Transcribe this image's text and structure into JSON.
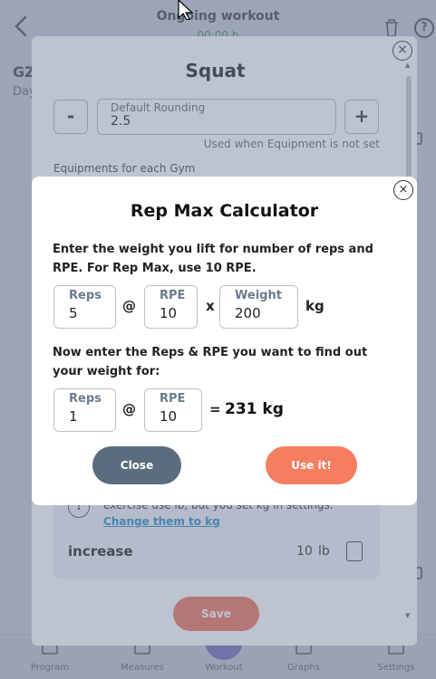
{
  "header": {
    "title": "Ongoing workout",
    "timer": "00:00 h"
  },
  "background": {
    "code": "GZ",
    "subtitle": "Day"
  },
  "bottom_nav": {
    "items": [
      "Program",
      "Measures",
      "Workout",
      "Graphs",
      "Settings"
    ]
  },
  "exercise_modal": {
    "title": "Squat",
    "minus_label": "-",
    "plus_label": "+",
    "rounding_label": "Default Rounding",
    "rounding_value": "2.5",
    "rounding_hint": "Used when Equipment is not set",
    "equipments_label": "Equipments for each Gym",
    "info_text": "exercise use lb, but you set kg in settings.",
    "info_link": "Change them to kg",
    "increase_label": "increase",
    "increase_value": "10",
    "increase_unit": "lb",
    "save_label": "Save"
  },
  "rep_max": {
    "title": "Rep Max Calculator",
    "instruction1": "Enter the weight you lift for number of reps and RPE. For Rep Max, use 10 RPE.",
    "instruction2": "Now enter the Reps & RPE you want to find out your weight for:",
    "row1": {
      "reps_label": "Reps",
      "reps_value": "5",
      "at": "@",
      "rpe_label": "RPE",
      "rpe_value": "10",
      "times": "x",
      "weight_label": "Weight",
      "weight_value": "200",
      "unit": "kg"
    },
    "row2": {
      "reps_label": "Reps",
      "reps_value": "1",
      "at": "@",
      "rpe_label": "RPE",
      "rpe_value": "10",
      "equals": "=",
      "result": "231 kg"
    },
    "close_label": "Close",
    "use_label": "Use it!"
  },
  "colors": {
    "close_button": "#5b6c7f",
    "use_button": "#f77d61",
    "save_button": "#f0735c",
    "overlay": "#6f7d96"
  },
  "icons": [
    "back-icon",
    "trash-icon",
    "help-icon",
    "close-icon",
    "info-icon",
    "calculator-icon",
    "cursor-icon"
  ]
}
